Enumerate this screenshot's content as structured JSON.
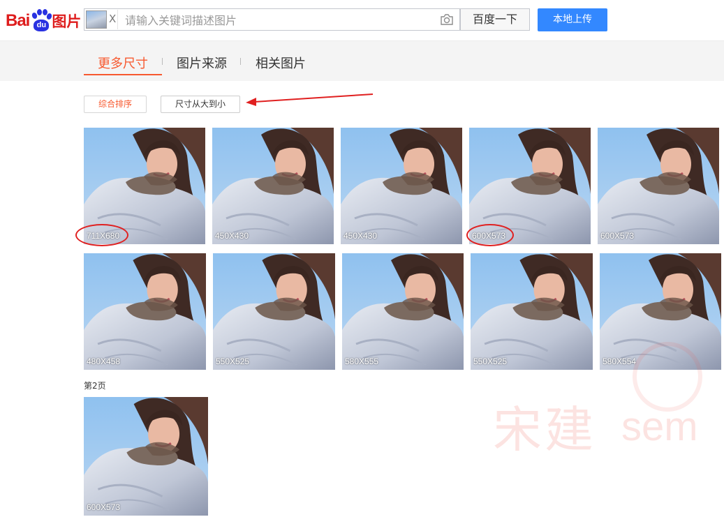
{
  "logo": {
    "text_bai": "Bai",
    "text_du": "du",
    "text_pic": "图片"
  },
  "search": {
    "placeholder": "请输入关键词描述图片",
    "thumb_close": "X"
  },
  "buttons": {
    "search": "百度一下",
    "upload": "本地上传"
  },
  "tabs": [
    {
      "label": "更多尺寸",
      "active": true
    },
    {
      "label": "图片来源",
      "active": false
    },
    {
      "label": "相关图片",
      "active": false
    }
  ],
  "sort": [
    {
      "label": "综合排序",
      "active": true
    },
    {
      "label": "尺寸从大到小",
      "active": false
    }
  ],
  "results_row1": [
    "711X680",
    "450X430",
    "450X430",
    "600X573",
    "600X573"
  ],
  "results_row2": [
    "480X458",
    "550X525",
    "580X555",
    "550X525",
    "580X554"
  ],
  "page2": {
    "label": "第2页",
    "results": [
      "600X573"
    ]
  },
  "watermark": {
    "text_cn": "宋建",
    "text_en": "sem"
  },
  "colors": {
    "accent": "#f7592f",
    "upload_button": "#3388ff",
    "annotation": "#e02020",
    "logo_red": "#de1d1d",
    "logo_blue": "#2932e1"
  }
}
